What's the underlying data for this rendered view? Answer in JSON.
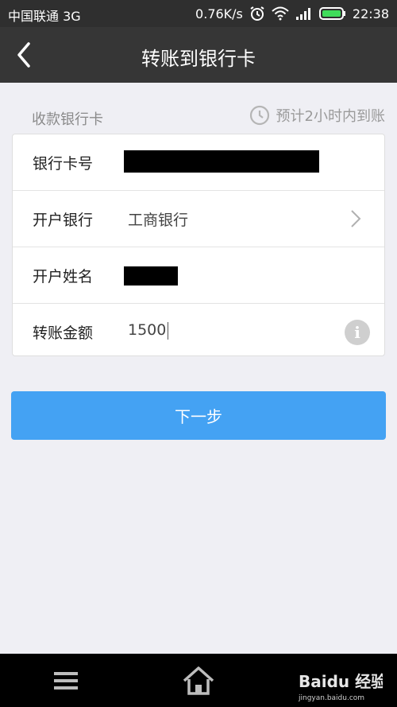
{
  "status_bar": {
    "carrier": "中国联通 3G",
    "speed": "0.76K/s",
    "time": "22:38"
  },
  "app_bar": {
    "title": "转账到银行卡"
  },
  "section": {
    "label": "收款银行卡",
    "eta": "预计2小时内到账"
  },
  "form": {
    "card_number_label": "银行卡号",
    "bank_label": "开户银行",
    "bank_value": "工商银行",
    "name_label": "开户姓名",
    "amount_label": "转账金额",
    "amount_value": "1500"
  },
  "next_button": {
    "label": "下一步"
  },
  "watermark": {
    "text": "Baidu 经验",
    "sub": "jingyan.baidu.com"
  },
  "colors": {
    "accent": "#44a2f3",
    "app_bar": "#363636",
    "background": "#efeff4"
  }
}
